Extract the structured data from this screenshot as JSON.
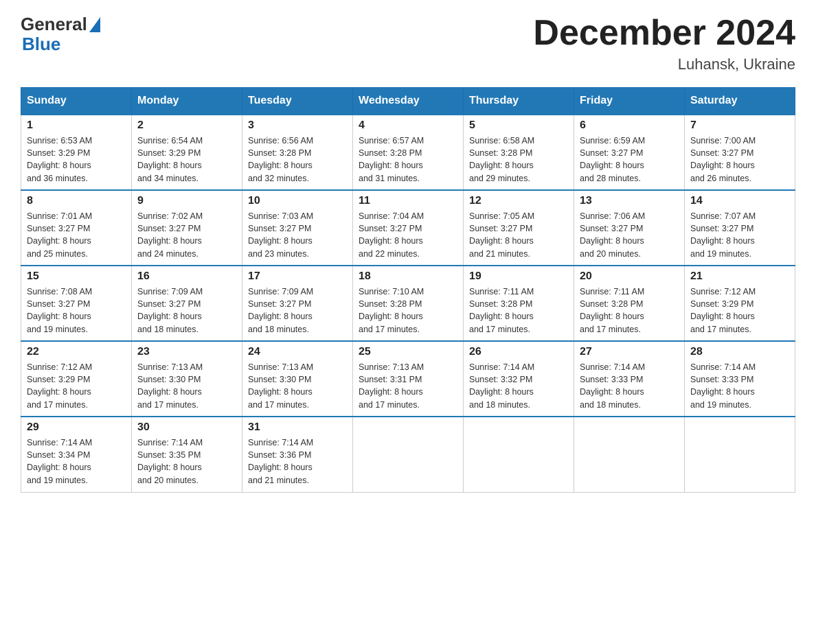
{
  "header": {
    "logo_general": "General",
    "logo_blue": "Blue",
    "month_title": "December 2024",
    "location": "Luhansk, Ukraine"
  },
  "weekdays": [
    "Sunday",
    "Monday",
    "Tuesday",
    "Wednesday",
    "Thursday",
    "Friday",
    "Saturday"
  ],
  "weeks": [
    [
      {
        "day": "1",
        "sunrise": "6:53 AM",
        "sunset": "3:29 PM",
        "daylight": "8 hours and 36 minutes."
      },
      {
        "day": "2",
        "sunrise": "6:54 AM",
        "sunset": "3:29 PM",
        "daylight": "8 hours and 34 minutes."
      },
      {
        "day": "3",
        "sunrise": "6:56 AM",
        "sunset": "3:28 PM",
        "daylight": "8 hours and 32 minutes."
      },
      {
        "day": "4",
        "sunrise": "6:57 AM",
        "sunset": "3:28 PM",
        "daylight": "8 hours and 31 minutes."
      },
      {
        "day": "5",
        "sunrise": "6:58 AM",
        "sunset": "3:28 PM",
        "daylight": "8 hours and 29 minutes."
      },
      {
        "day": "6",
        "sunrise": "6:59 AM",
        "sunset": "3:27 PM",
        "daylight": "8 hours and 28 minutes."
      },
      {
        "day": "7",
        "sunrise": "7:00 AM",
        "sunset": "3:27 PM",
        "daylight": "8 hours and 26 minutes."
      }
    ],
    [
      {
        "day": "8",
        "sunrise": "7:01 AM",
        "sunset": "3:27 PM",
        "daylight": "8 hours and 25 minutes."
      },
      {
        "day": "9",
        "sunrise": "7:02 AM",
        "sunset": "3:27 PM",
        "daylight": "8 hours and 24 minutes."
      },
      {
        "day": "10",
        "sunrise": "7:03 AM",
        "sunset": "3:27 PM",
        "daylight": "8 hours and 23 minutes."
      },
      {
        "day": "11",
        "sunrise": "7:04 AM",
        "sunset": "3:27 PM",
        "daylight": "8 hours and 22 minutes."
      },
      {
        "day": "12",
        "sunrise": "7:05 AM",
        "sunset": "3:27 PM",
        "daylight": "8 hours and 21 minutes."
      },
      {
        "day": "13",
        "sunrise": "7:06 AM",
        "sunset": "3:27 PM",
        "daylight": "8 hours and 20 minutes."
      },
      {
        "day": "14",
        "sunrise": "7:07 AM",
        "sunset": "3:27 PM",
        "daylight": "8 hours and 19 minutes."
      }
    ],
    [
      {
        "day": "15",
        "sunrise": "7:08 AM",
        "sunset": "3:27 PM",
        "daylight": "8 hours and 19 minutes."
      },
      {
        "day": "16",
        "sunrise": "7:09 AM",
        "sunset": "3:27 PM",
        "daylight": "8 hours and 18 minutes."
      },
      {
        "day": "17",
        "sunrise": "7:09 AM",
        "sunset": "3:27 PM",
        "daylight": "8 hours and 18 minutes."
      },
      {
        "day": "18",
        "sunrise": "7:10 AM",
        "sunset": "3:28 PM",
        "daylight": "8 hours and 17 minutes."
      },
      {
        "day": "19",
        "sunrise": "7:11 AM",
        "sunset": "3:28 PM",
        "daylight": "8 hours and 17 minutes."
      },
      {
        "day": "20",
        "sunrise": "7:11 AM",
        "sunset": "3:28 PM",
        "daylight": "8 hours and 17 minutes."
      },
      {
        "day": "21",
        "sunrise": "7:12 AM",
        "sunset": "3:29 PM",
        "daylight": "8 hours and 17 minutes."
      }
    ],
    [
      {
        "day": "22",
        "sunrise": "7:12 AM",
        "sunset": "3:29 PM",
        "daylight": "8 hours and 17 minutes."
      },
      {
        "day": "23",
        "sunrise": "7:13 AM",
        "sunset": "3:30 PM",
        "daylight": "8 hours and 17 minutes."
      },
      {
        "day": "24",
        "sunrise": "7:13 AM",
        "sunset": "3:30 PM",
        "daylight": "8 hours and 17 minutes."
      },
      {
        "day": "25",
        "sunrise": "7:13 AM",
        "sunset": "3:31 PM",
        "daylight": "8 hours and 17 minutes."
      },
      {
        "day": "26",
        "sunrise": "7:14 AM",
        "sunset": "3:32 PM",
        "daylight": "8 hours and 18 minutes."
      },
      {
        "day": "27",
        "sunrise": "7:14 AM",
        "sunset": "3:33 PM",
        "daylight": "8 hours and 18 minutes."
      },
      {
        "day": "28",
        "sunrise": "7:14 AM",
        "sunset": "3:33 PM",
        "daylight": "8 hours and 19 minutes."
      }
    ],
    [
      {
        "day": "29",
        "sunrise": "7:14 AM",
        "sunset": "3:34 PM",
        "daylight": "8 hours and 19 minutes."
      },
      {
        "day": "30",
        "sunrise": "7:14 AM",
        "sunset": "3:35 PM",
        "daylight": "8 hours and 20 minutes."
      },
      {
        "day": "31",
        "sunrise": "7:14 AM",
        "sunset": "3:36 PM",
        "daylight": "8 hours and 21 minutes."
      },
      null,
      null,
      null,
      null
    ]
  ],
  "labels": {
    "sunrise": "Sunrise:",
    "sunset": "Sunset:",
    "daylight": "Daylight:"
  }
}
